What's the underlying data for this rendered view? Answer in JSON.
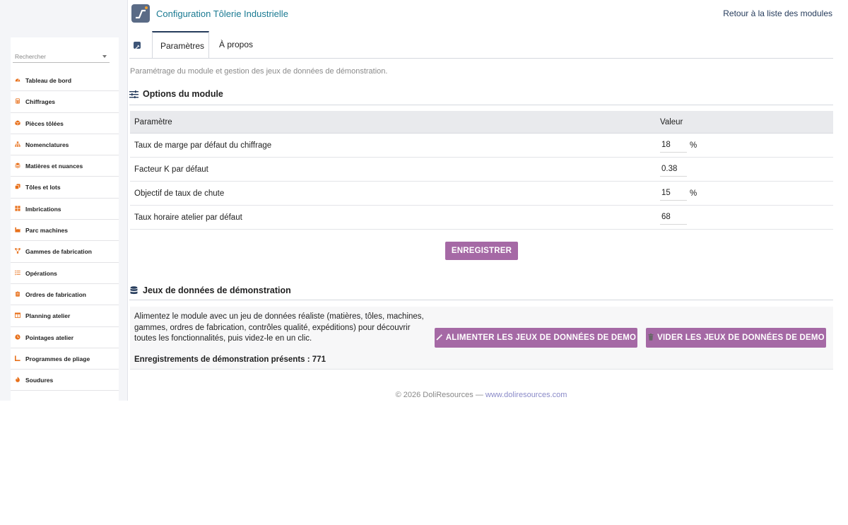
{
  "header": {
    "title": "Configuration Tôlerie Industrielle",
    "back_link": "Retour à la liste des modules"
  },
  "sidebar": {
    "search_placeholder": "Rechercher",
    "items": [
      {
        "label": "Tableau de bord",
        "icon": "dashboard-icon"
      },
      {
        "label": "Chiffrages",
        "icon": "calculator-icon"
      },
      {
        "label": "Pièces tôlées",
        "icon": "box-icon"
      },
      {
        "label": "Nomenclatures",
        "icon": "sitemap-icon"
      },
      {
        "label": "Matières et nuances",
        "icon": "layers-icon"
      },
      {
        "label": "Tôles et lots",
        "icon": "copy-icon"
      },
      {
        "label": "Imbrications",
        "icon": "grid-icon"
      },
      {
        "label": "Parc machines",
        "icon": "factory-icon"
      },
      {
        "label": "Gammes de fabrication",
        "icon": "flow-icon"
      },
      {
        "label": "Opérations",
        "icon": "list-icon"
      },
      {
        "label": "Ordres de fabrication",
        "icon": "clipboard-icon"
      },
      {
        "label": "Planning atelier",
        "icon": "calendar-icon"
      },
      {
        "label": "Pointages atelier",
        "icon": "clock-icon"
      },
      {
        "label": "Programmes de pliage",
        "icon": "bend-icon"
      },
      {
        "label": "Soudures",
        "icon": "flame-icon"
      }
    ]
  },
  "tabs": {
    "params": "Paramètres",
    "about": "À propos"
  },
  "intro": "Paramétrage du module et gestion des jeux de données de démonstration.",
  "options": {
    "title": "Options du module",
    "col_param": "Paramètre",
    "col_value": "Valeur",
    "rows": [
      {
        "label": "Taux de marge par défaut du chiffrage",
        "value": "18",
        "unit": "%"
      },
      {
        "label": "Facteur K par défaut",
        "value": "0.38",
        "unit": ""
      },
      {
        "label": "Objectif de taux de chute",
        "value": "15",
        "unit": "%"
      },
      {
        "label": "Taux horaire atelier par défaut",
        "value": "68",
        "unit": ""
      }
    ],
    "save_label": "ENREGISTRER"
  },
  "demo": {
    "title": "Jeux de données de démonstration",
    "description": "Alimentez le module avec un jeu de données réaliste (matières, tôles, machines, gammes, ordres de fabrication, contrôles qualité, expéditions) pour découvrir toutes les fonctionnalités, puis videz-le en un clic.",
    "seed_label": "ALIMENTER LES JEUX DE DONNÉES DE DEMO",
    "purge_label": "VIDER LES JEUX DE DONNÉES DE DEMO",
    "count_label": "Enregistrements de démonstration présents : 771"
  },
  "footer": {
    "copyright": "© 2026 DoliResources — ",
    "link": "www.doliresources.com"
  },
  "colors": {
    "accent_button": "#a569a5",
    "title_teal": "#1a7a92",
    "menu_icon_orange": "#e8701a"
  }
}
